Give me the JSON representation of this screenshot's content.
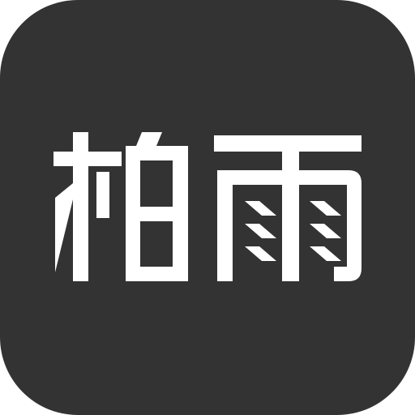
{
  "app_icon": {
    "label": "柏雨",
    "icon": "logo-icon",
    "colors": {
      "background": "#333333",
      "glyph": "#ffffff",
      "page": "#ffffff"
    }
  }
}
